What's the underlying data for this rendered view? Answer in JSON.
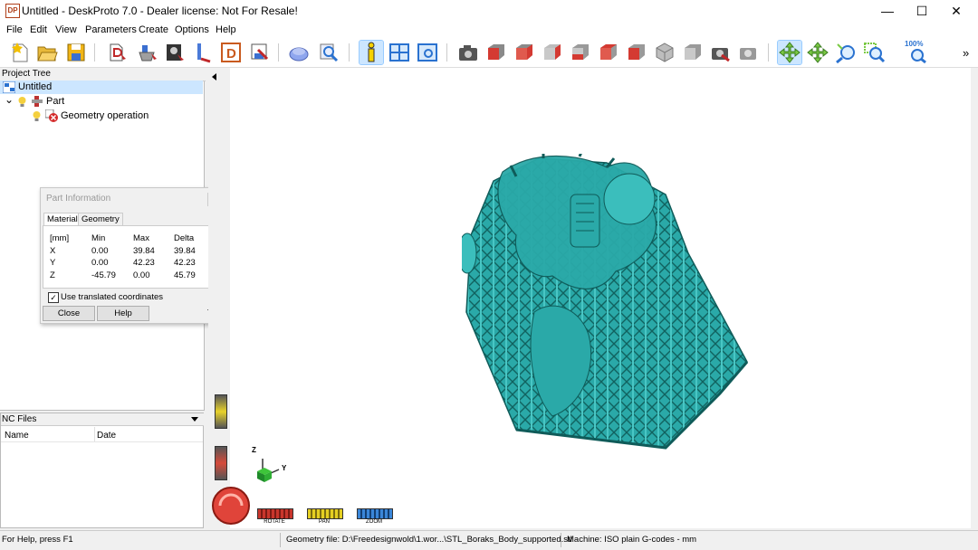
{
  "window": {
    "app_icon": "DP",
    "title": "Untitled - DeskProto 7.0 - Dealer license: Not For Resale!",
    "controls": {
      "minimize": "—",
      "maximize": "☐",
      "close": "✕"
    }
  },
  "menu": [
    "File",
    "Edit",
    "View",
    "Parameters",
    "Create",
    "Options",
    "Help"
  ],
  "toolbar": {
    "buttons": [
      "new-file-icon",
      "open-folder-icon",
      "save-disk-icon",
      "wizard-icon",
      "part-wizard-icon",
      "image-wizard-icon",
      "drill-wizard-icon",
      "d-wizard-icon",
      "export-icon",
      "shaded-view-icon",
      "zoom-to-fit-icon",
      "info-icon",
      "layout-icon",
      "preview-icon",
      "camera-icon",
      "view-front-icon",
      "view-right-icon",
      "view-back-icon",
      "view-left-icon",
      "view-top-icon",
      "view-bottom-icon",
      "view-iso-icon",
      "view-iso2-icon",
      "camera-rotate-icon",
      "camera-lock-icon",
      "rotate-mode-icon",
      "pan-mode-icon",
      "zoom-in-icon",
      "zoom-window-icon",
      "zoom-100-icon"
    ],
    "zoom_label": "100%",
    "overflow": "»"
  },
  "project_tree": {
    "header": "Project Tree",
    "root": "Untitled",
    "part": "Part",
    "operation": "Geometry operation",
    "expander": "⌄"
  },
  "part_info": {
    "title": "Part Information",
    "tabs": [
      "Material",
      "Geometry"
    ],
    "columns": [
      "[mm]",
      "Min",
      "Max",
      "Delta"
    ],
    "rows": [
      [
        "X",
        "0.00",
        "39.84",
        "39.84"
      ],
      [
        "Y",
        "0.00",
        "42.23",
        "42.23"
      ],
      [
        "Z",
        "-45.79",
        "0.00",
        "45.79"
      ]
    ],
    "checkbox_label": "Use translated coordinates",
    "checkbox_checked": true,
    "close_label": "Close",
    "help_label": "Help"
  },
  "nc_files": {
    "header": "NC Files",
    "columns": [
      "Name",
      "Date"
    ]
  },
  "viewport": {
    "axis_z": "Z",
    "axis_y": "Y",
    "controls": [
      "ROTATE",
      "PAN",
      "ZOOM"
    ],
    "model_color": "#2aa9a8",
    "model_dark_color": "#17807f"
  },
  "status": {
    "help": "For Help, press F1",
    "geometry_file": "Geometry file: D:\\Freedesignwold\\1.wor...\\STL_Boraks_Body_supported.stl",
    "machine": "Machine: ISO plain G-codes - mm"
  }
}
